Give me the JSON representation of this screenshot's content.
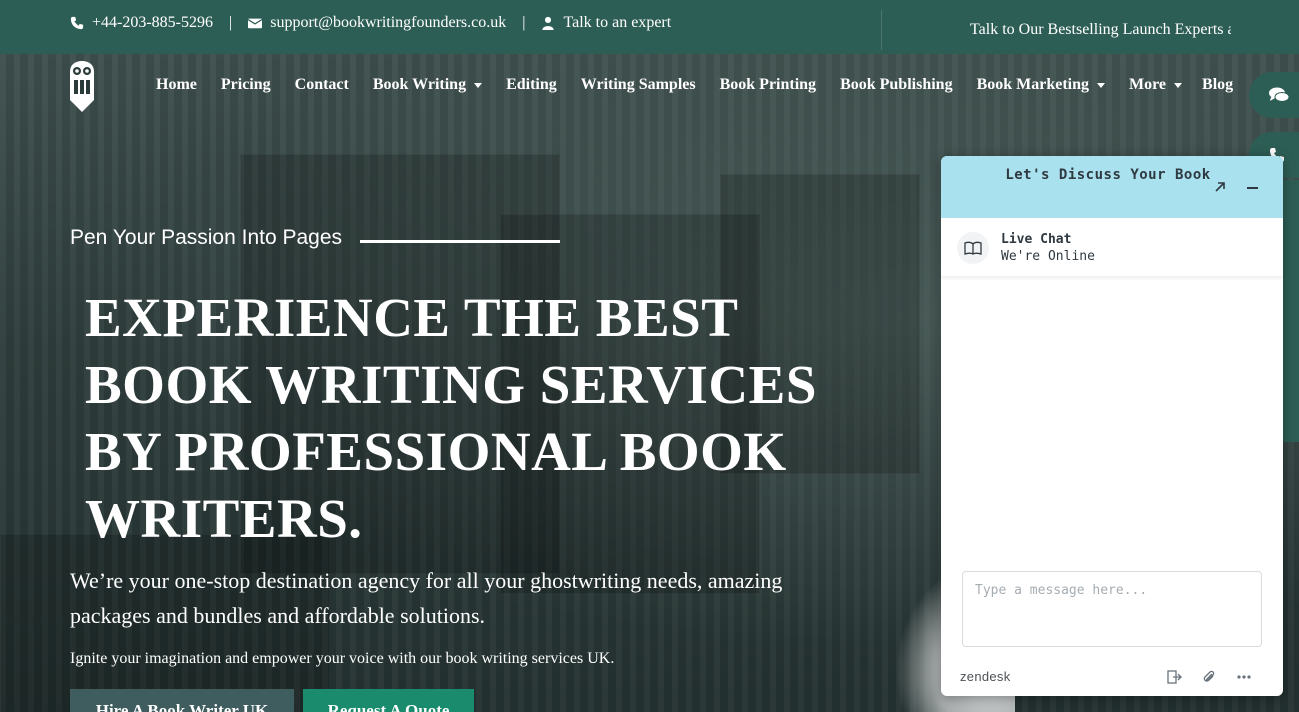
{
  "topbar": {
    "phone": "+44-203-885-5296",
    "email": "support@bookwritingfounders.co.uk",
    "expert": "Talk to an expert",
    "separator": "|",
    "marquee": "Talk to Our Bestselling Launch Experts a"
  },
  "nav": {
    "items": [
      {
        "label": "Home",
        "dropdown": false
      },
      {
        "label": "Pricing",
        "dropdown": false
      },
      {
        "label": "Contact",
        "dropdown": false
      },
      {
        "label": "Book Writing",
        "dropdown": true
      },
      {
        "label": "Editing",
        "dropdown": false
      },
      {
        "label": "Writing Samples",
        "dropdown": false
      },
      {
        "label": "Book Printing",
        "dropdown": false
      },
      {
        "label": "Book Publishing",
        "dropdown": false
      },
      {
        "label": "Book Marketing",
        "dropdown": true
      },
      {
        "label": "More",
        "dropdown": true
      },
      {
        "label": "Blog",
        "dropdown": false
      }
    ]
  },
  "hero": {
    "tagline": "Pen Your Passion Into Pages",
    "headline": "EXPERIENCE THE BEST BOOK WRITING SERVICES BY PROFESSIONAL BOOK WRITERS.",
    "subcopy": "We’re your one-stop destination agency for all your ghostwriting needs, amazing packages and bundles and affordable solutions.",
    "smallcopy": "Ignite your imagination and empower your voice with our book writing services UK.",
    "btn_hire": "Hire A Book Writer UK",
    "btn_quote": "Request A Quote"
  },
  "chat": {
    "title": "Let's Discuss Your Book",
    "agent_name": "Live Chat",
    "agent_status": "We're Online",
    "input_placeholder": "Type a message here...",
    "brand": "zendesk"
  },
  "colors": {
    "topbar": "#2d5e55",
    "chat_header": "#a9e1ef",
    "quote_button": "#1a8c6d",
    "hire_button": "#3f5d5f"
  }
}
